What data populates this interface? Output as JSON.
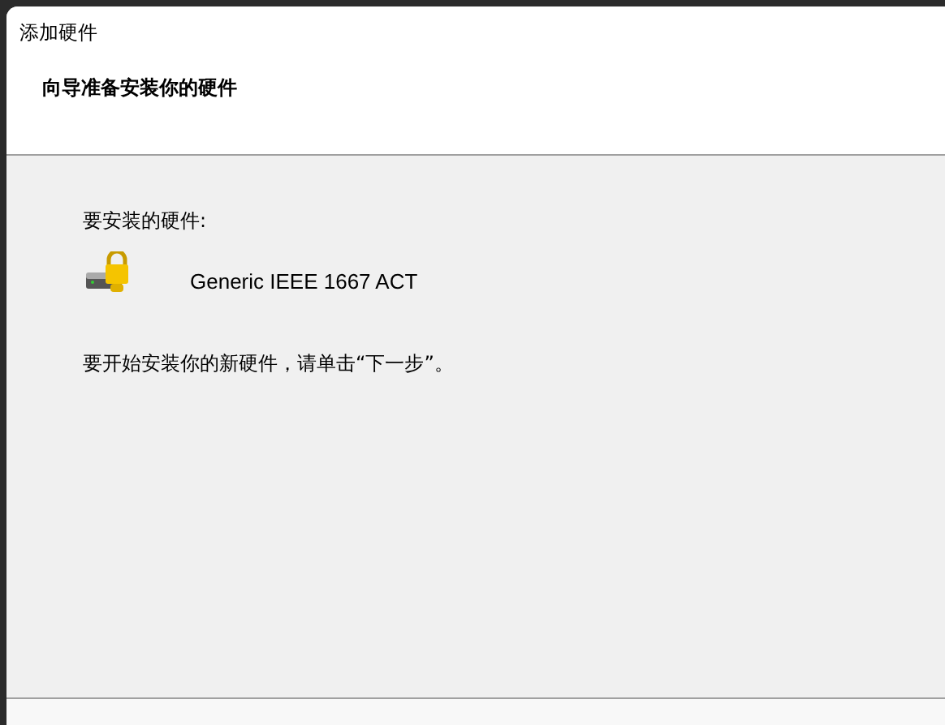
{
  "window": {
    "title": "添加硬件"
  },
  "header": {
    "title": "向导准备安装你的硬件"
  },
  "body": {
    "label": "要安装的硬件:",
    "device": {
      "name": "Generic IEEE 1667 ACT"
    },
    "instruction": "要开始安装你的新硬件，请单击“下一步”。"
  }
}
